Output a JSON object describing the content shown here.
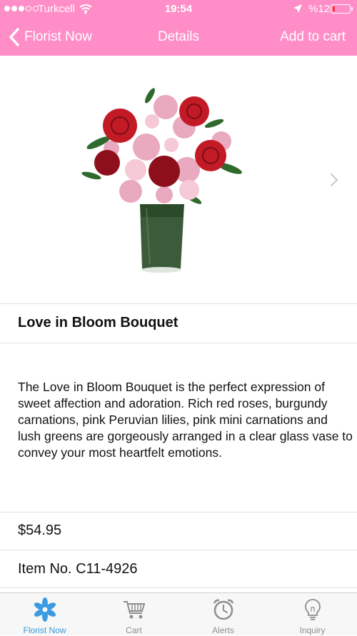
{
  "status_bar": {
    "carrier": "Turkcell",
    "time": "19:54",
    "battery_text": "%12",
    "battery_level": 0.12,
    "signal_bars_filled": 3,
    "signal_bars_total": 5
  },
  "nav": {
    "back_label": "Florist Now",
    "title": "Details",
    "action_label": "Add to cart"
  },
  "product": {
    "title": "Love in Bloom Bouquet",
    "description": "The Love in Bloom Bouquet is the perfect expression of sweet affection and adoration. Rich red roses, burgundy carnations, pink Peruvian lilies, pink mini carnations and lush greens are gorgeously arranged in a clear glass vase to convey your most heartfelt emotions.",
    "price": "$54.95",
    "item_number": "Item No. C11-4926"
  },
  "tabs": [
    {
      "label": "Florist Now",
      "icon": "flower-icon",
      "active": true
    },
    {
      "label": "Cart",
      "icon": "cart-icon",
      "active": false
    },
    {
      "label": "Alerts",
      "icon": "alarm-clock-icon",
      "active": false
    },
    {
      "label": "Inquiry",
      "icon": "lightbulb-icon",
      "active": false
    }
  ],
  "colors": {
    "header": "#ff8dc7",
    "active_tab": "#3a9be0",
    "inactive_tab": "#8e8e8e",
    "battery_low": "#ff2a2a"
  }
}
